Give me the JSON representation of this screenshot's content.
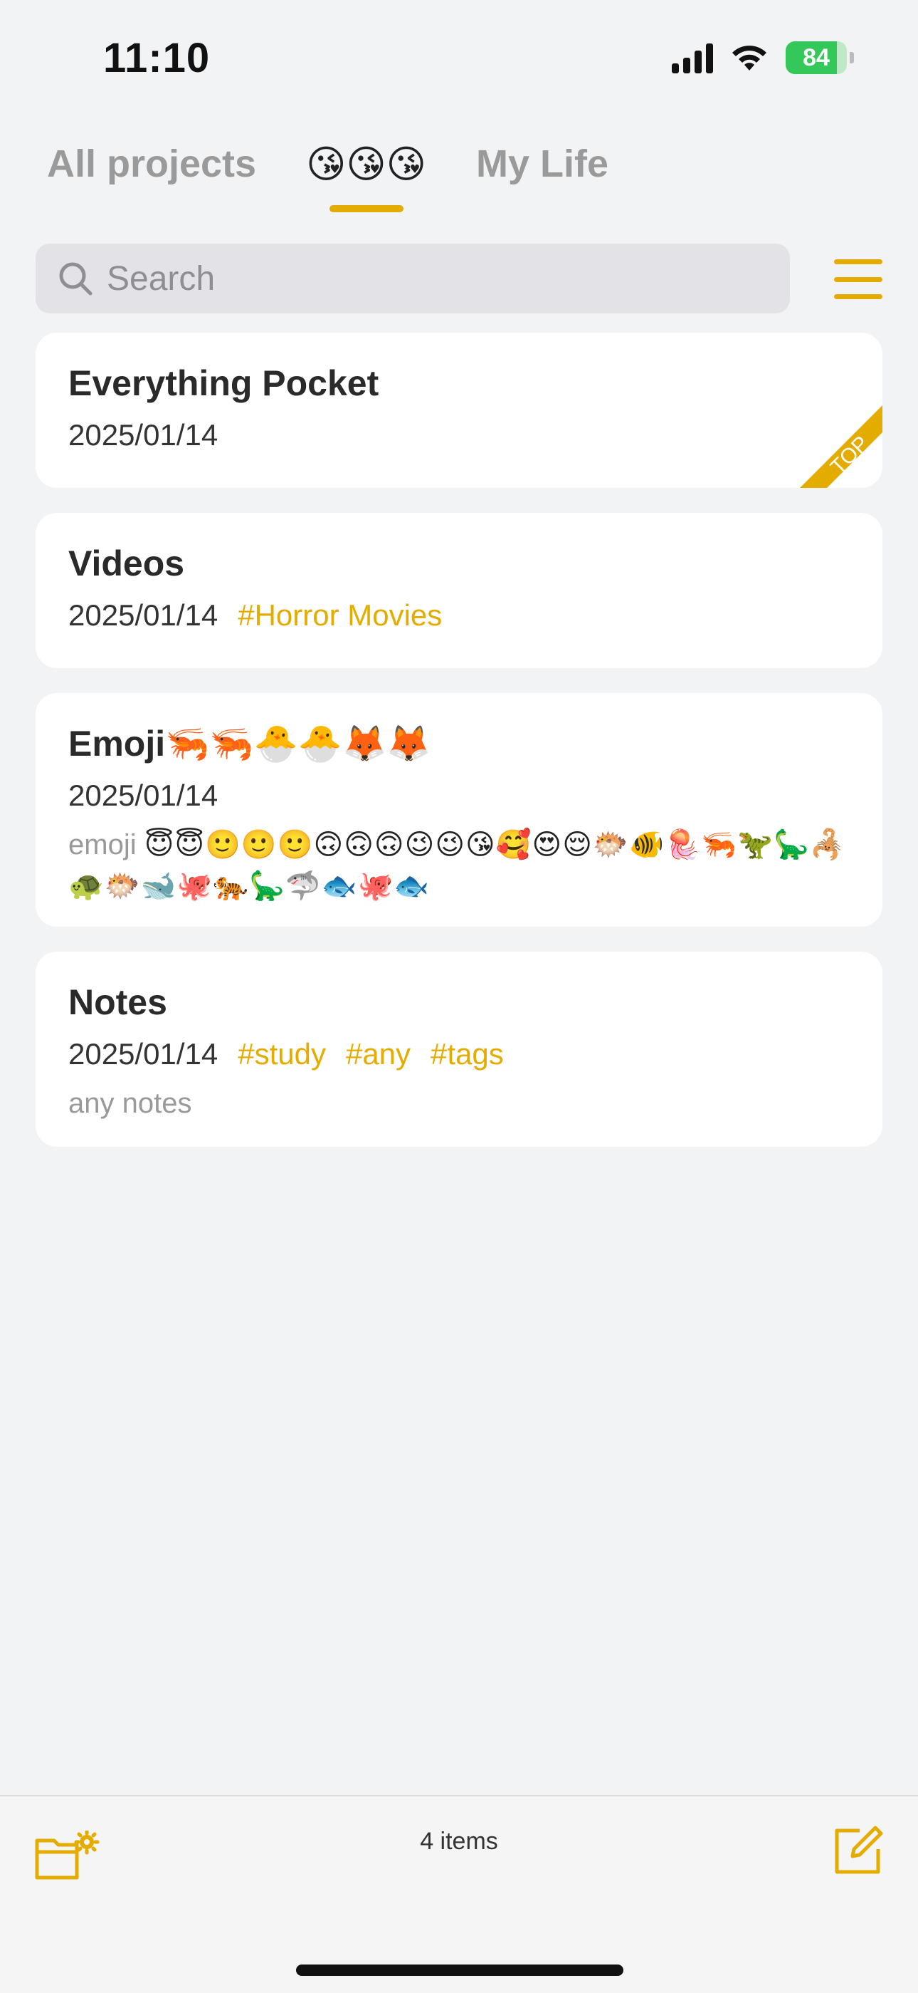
{
  "status_bar": {
    "time": "11:10",
    "battery_level": "84",
    "battery_fraction": 0.84,
    "battery_charging": true
  },
  "tabs": [
    {
      "label": "All projects",
      "active": false
    },
    {
      "label": "😘😘😘",
      "active": true
    },
    {
      "label": "My Life",
      "active": false
    }
  ],
  "search": {
    "placeholder": "Search",
    "value": ""
  },
  "notes": [
    {
      "title": "Everything Pocket",
      "date": "2025/01/14",
      "pinned": true,
      "pin_label": "TOP",
      "tags": []
    },
    {
      "title": "Videos",
      "date": "2025/01/14",
      "tags": [
        "#Horror Movies"
      ]
    },
    {
      "title": "Emoji🦐🦐🐣🐣🦊🦊",
      "date": "2025/01/14",
      "tags": [],
      "preview_label": "emoji ",
      "preview_emoji": "😇😇🙂🙂🙂🙃🙃🙃😉😉😘🥰😍😌🐡🐠🪼🦐🦖🦕🦂🐢🐡🐋🐙🐅🦕🦈🐟🐙🐟"
    },
    {
      "title": "Notes",
      "date": "2025/01/14",
      "tags": [
        "#study",
        "#any",
        "#tags"
      ],
      "preview_label": "any notes"
    }
  ],
  "bottom_bar": {
    "item_count": "4 items",
    "left_icon": "folder-settings-icon",
    "right_icon": "compose-icon"
  },
  "colors": {
    "accent": "#e5ac00",
    "background": "#f2f3f5",
    "card": "#ffffff",
    "muted_text": "#9a9a9a",
    "battery": "#34c759"
  }
}
